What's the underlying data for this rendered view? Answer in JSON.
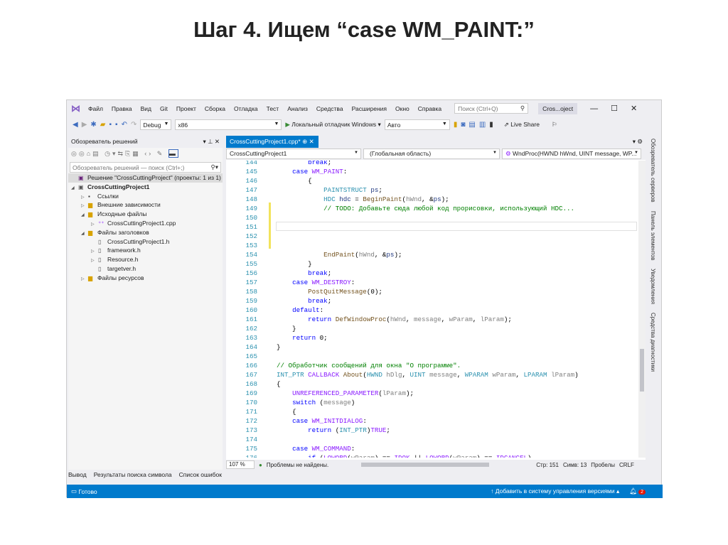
{
  "slide_title": "Шаг 4. Ищем “case WM_PAINT:”",
  "menu": [
    "Файл",
    "Правка",
    "Вид",
    "Git",
    "Проект",
    "Сборка",
    "Отладка",
    "Тест",
    "Анализ",
    "Средства",
    "Расширения",
    "Окно",
    "Справка"
  ],
  "search_placeholder": "Поиск (Ctrl+Q)",
  "project_badge": "Cros...oject",
  "toolbar": {
    "config": "Debug",
    "platform": "x86",
    "debugger": "Локальный отладчик Windows",
    "target": "Авто",
    "live_share": "Live Share"
  },
  "solution_explorer": {
    "title": "Обозреватель решений",
    "search_placeholder": "Обозреватель решений — поиск (Ctrl+;)",
    "items": [
      {
        "label": "Решение \"CrossCuttingProject\" (проекты: 1 из 1)",
        "icon": "solution-icon",
        "depth": 0,
        "twisty": "",
        "selected": true
      },
      {
        "label": "CrossCuttingProject1",
        "icon": "project-icon",
        "depth": 0,
        "twisty": "◢",
        "bold": true
      },
      {
        "label": "Ссылки",
        "icon": "references-icon",
        "depth": 1,
        "twisty": "▷"
      },
      {
        "label": "Внешние зависимости",
        "icon": "folder-icon",
        "depth": 1,
        "twisty": "▷"
      },
      {
        "label": "Исходные файлы",
        "icon": "folder-icon",
        "depth": 1,
        "twisty": "◢"
      },
      {
        "label": "CrossCuttingProject1.cpp",
        "icon": "cpp-file-icon",
        "depth": 2,
        "twisty": "▷"
      },
      {
        "label": "Файлы заголовков",
        "icon": "folder-icon",
        "depth": 1,
        "twisty": "◢"
      },
      {
        "label": "CrossCuttingProject1.h",
        "icon": "header-file-icon",
        "depth": 2,
        "twisty": ""
      },
      {
        "label": "framework.h",
        "icon": "header-file-icon",
        "depth": 2,
        "twisty": "▷"
      },
      {
        "label": "Resource.h",
        "icon": "header-file-icon",
        "depth": 2,
        "twisty": "▷"
      },
      {
        "label": "targetver.h",
        "icon": "header-file-icon",
        "depth": 2,
        "twisty": ""
      },
      {
        "label": "Файлы ресурсов",
        "icon": "folder-icon",
        "depth": 1,
        "twisty": "▷"
      }
    ]
  },
  "editor": {
    "tab": "CrossCuttingProject1.cpp*",
    "nav_project": "CrossCuttingProject1",
    "nav_scope": "(Глобальная область)",
    "nav_member": "WndProc(HWND hWnd, UINT message, WP...",
    "lines": [
      {
        "n": "144",
        "t": [
          [
            "        ",
            "pl"
          ],
          [
            "break",
            "kw"
          ],
          [
            ";",
            "pl"
          ]
        ]
      },
      {
        "n": "145",
        "t": [
          [
            "    ",
            "pl"
          ],
          [
            "case ",
            "kw"
          ],
          [
            "WM_PAINT",
            "mac"
          ],
          [
            ":",
            "pl"
          ]
        ]
      },
      {
        "n": "146",
        "t": [
          [
            "        {",
            "pl"
          ]
        ]
      },
      {
        "n": "147",
        "t": [
          [
            "            ",
            "pl"
          ],
          [
            "PAINTSTRUCT ",
            "ty"
          ],
          [
            "ps",
            "lv"
          ],
          [
            ";",
            "pl"
          ]
        ]
      },
      {
        "n": "148",
        "t": [
          [
            "            ",
            "pl"
          ],
          [
            "HDC ",
            "ty"
          ],
          [
            "hdc",
            "lv"
          ],
          [
            " = ",
            "pl"
          ],
          [
            "BeginPaint",
            "fn"
          ],
          [
            "(",
            "pl"
          ],
          [
            "hWnd",
            "pr"
          ],
          [
            ", &",
            "pl"
          ],
          [
            "ps",
            "lv"
          ],
          [
            ");",
            "pl"
          ]
        ]
      },
      {
        "n": "149",
        "t": [
          [
            "            ",
            "pl"
          ],
          [
            "// TODO: Добавьте сюда любой код прорисовки, использующий HDC...",
            "cm"
          ]
        ]
      },
      {
        "n": "150",
        "t": []
      },
      {
        "n": "151",
        "t": []
      },
      {
        "n": "152",
        "t": []
      },
      {
        "n": "153",
        "t": []
      },
      {
        "n": "154",
        "t": [
          [
            "            ",
            "pl"
          ],
          [
            "EndPaint",
            "fn"
          ],
          [
            "(",
            "pl"
          ],
          [
            "hWnd",
            "pr"
          ],
          [
            ", &",
            "pl"
          ],
          [
            "ps",
            "lv"
          ],
          [
            ");",
            "pl"
          ]
        ]
      },
      {
        "n": "155",
        "t": [
          [
            "        }",
            "pl"
          ]
        ]
      },
      {
        "n": "156",
        "t": [
          [
            "        ",
            "pl"
          ],
          [
            "break",
            "kw"
          ],
          [
            ";",
            "pl"
          ]
        ]
      },
      {
        "n": "157",
        "t": [
          [
            "    ",
            "pl"
          ],
          [
            "case ",
            "kw"
          ],
          [
            "WM_DESTROY",
            "mac"
          ],
          [
            ":",
            "pl"
          ]
        ]
      },
      {
        "n": "158",
        "t": [
          [
            "        ",
            "pl"
          ],
          [
            "PostQuitMessage",
            "fn"
          ],
          [
            "(0);",
            "pl"
          ]
        ]
      },
      {
        "n": "159",
        "t": [
          [
            "        ",
            "pl"
          ],
          [
            "break",
            "kw"
          ],
          [
            ";",
            "pl"
          ]
        ]
      },
      {
        "n": "160",
        "t": [
          [
            "    ",
            "pl"
          ],
          [
            "default",
            "kw"
          ],
          [
            ":",
            "pl"
          ]
        ]
      },
      {
        "n": "161",
        "t": [
          [
            "        ",
            "pl"
          ],
          [
            "return ",
            "kw"
          ],
          [
            "DefWindowProc",
            "fn"
          ],
          [
            "(",
            "pl"
          ],
          [
            "hWnd",
            "pr"
          ],
          [
            ", ",
            "pl"
          ],
          [
            "message",
            "pr"
          ],
          [
            ", ",
            "pl"
          ],
          [
            "wParam",
            "pr"
          ],
          [
            ", ",
            "pl"
          ],
          [
            "lParam",
            "pr"
          ],
          [
            ");",
            "pl"
          ]
        ]
      },
      {
        "n": "162",
        "t": [
          [
            "    }",
            "pl"
          ]
        ]
      },
      {
        "n": "163",
        "t": [
          [
            "    ",
            "pl"
          ],
          [
            "return ",
            "kw"
          ],
          [
            "0;",
            "pl"
          ]
        ]
      },
      {
        "n": "164",
        "t": [
          [
            "}",
            "pl"
          ]
        ]
      },
      {
        "n": "165",
        "t": []
      },
      {
        "n": "166",
        "t": [
          [
            "// Обработчик сообщений для окна \"О программе\".",
            "cm"
          ]
        ]
      },
      {
        "n": "167",
        "t": [
          [
            "INT_PTR ",
            "ty"
          ],
          [
            "CALLBACK ",
            "mac"
          ],
          [
            "About",
            "fn"
          ],
          [
            "(",
            "pl"
          ],
          [
            "HWND ",
            "ty"
          ],
          [
            "hDlg",
            "pr"
          ],
          [
            ", ",
            "pl"
          ],
          [
            "UINT ",
            "ty"
          ],
          [
            "message",
            "pr"
          ],
          [
            ", ",
            "pl"
          ],
          [
            "WPARAM ",
            "ty"
          ],
          [
            "wParam",
            "pr"
          ],
          [
            ", ",
            "pl"
          ],
          [
            "LPARAM ",
            "ty"
          ],
          [
            "lParam",
            "pr"
          ],
          [
            ")",
            "pl"
          ]
        ]
      },
      {
        "n": "168",
        "t": [
          [
            "{",
            "pl"
          ]
        ]
      },
      {
        "n": "169",
        "t": [
          [
            "    ",
            "pl"
          ],
          [
            "UNREFERENCED_PARAMETER",
            "mac"
          ],
          [
            "(",
            "pl"
          ],
          [
            "lParam",
            "pr"
          ],
          [
            ");",
            "pl"
          ]
        ]
      },
      {
        "n": "170",
        "t": [
          [
            "    ",
            "pl"
          ],
          [
            "switch ",
            "kw"
          ],
          [
            "(",
            "pl"
          ],
          [
            "message",
            "pr"
          ],
          [
            ")",
            "pl"
          ]
        ]
      },
      {
        "n": "171",
        "t": [
          [
            "    {",
            "pl"
          ]
        ]
      },
      {
        "n": "172",
        "t": [
          [
            "    ",
            "pl"
          ],
          [
            "case ",
            "kw"
          ],
          [
            "WM_INITDIALOG",
            "mac"
          ],
          [
            ":",
            "pl"
          ]
        ]
      },
      {
        "n": "173",
        "t": [
          [
            "        ",
            "pl"
          ],
          [
            "return ",
            "kw"
          ],
          [
            "(",
            "pl"
          ],
          [
            "INT_PTR",
            "ty"
          ],
          [
            ")",
            "pl"
          ],
          [
            "TRUE",
            "mac"
          ],
          [
            ";",
            "pl"
          ]
        ]
      },
      {
        "n": "174",
        "t": []
      },
      {
        "n": "175",
        "t": [
          [
            "    ",
            "pl"
          ],
          [
            "case ",
            "kw"
          ],
          [
            "WM_COMMAND",
            "mac"
          ],
          [
            ":",
            "pl"
          ]
        ]
      },
      {
        "n": "176",
        "t": [
          [
            "        ",
            "pl"
          ],
          [
            "if ",
            "kw"
          ],
          [
            "(",
            "pl"
          ],
          [
            "LOWORD",
            "mac"
          ],
          [
            "(",
            "pl"
          ],
          [
            "wParam",
            "pr"
          ],
          [
            ") == ",
            "pl"
          ],
          [
            "IDOK",
            "mac"
          ],
          [
            " || ",
            "pl"
          ],
          [
            "LOWORD",
            "mac"
          ],
          [
            "(",
            "pl"
          ],
          [
            "wParam",
            "pr"
          ],
          [
            ") == ",
            "pl"
          ],
          [
            "IDCANCEL",
            "mac"
          ],
          [
            ")",
            "pl"
          ]
        ]
      }
    ],
    "zoom": "107 %",
    "problems": "Проблемы не найдены.",
    "line": "Стр: 151",
    "col": "Симв: 13",
    "spaces": "Пробелы",
    "eol": "CRLF"
  },
  "right_tabs": [
    "Обозреватель серверов",
    "Панель элементов",
    "Уведомления",
    "Средства диагностики"
  ],
  "bottom_tabs": [
    "Вывод",
    "Результаты поиска символа",
    "Список ошибок"
  ],
  "status": {
    "ready": "Готово",
    "vcs": "Добавить в систему управления версиями",
    "notifications": "2"
  }
}
